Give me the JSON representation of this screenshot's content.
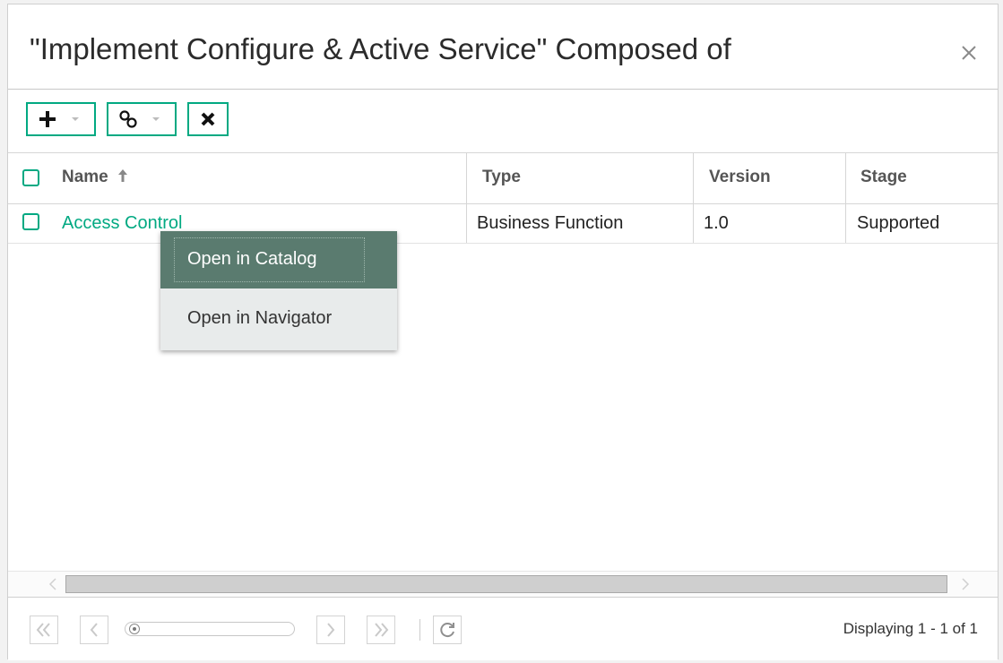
{
  "dialog": {
    "title": "\"Implement Configure & Active Service\" Composed of",
    "close_icon": "close-icon"
  },
  "toolbar": {
    "add_icon": "plus-icon",
    "link_icon": "link-icon",
    "delete_icon": "x-icon",
    "accent_color": "#01a982"
  },
  "grid": {
    "columns": [
      "Name",
      "Type",
      "Version",
      "Stage"
    ],
    "sort_icon": "arrow-up-icon",
    "rows": [
      {
        "name": "Access Control",
        "type": "Business Function",
        "version": "1.0",
        "stage": "Supported"
      }
    ]
  },
  "context_menu": {
    "items": [
      "Open in Catalog",
      "Open in Navigator"
    ],
    "active_color": "#5a7b6f"
  },
  "pager": {
    "display_text": "Displaying 1 - 1 of 1",
    "icons": [
      "first-page-icon",
      "prev-page-icon",
      "next-page-icon",
      "last-page-icon",
      "refresh-icon"
    ]
  }
}
